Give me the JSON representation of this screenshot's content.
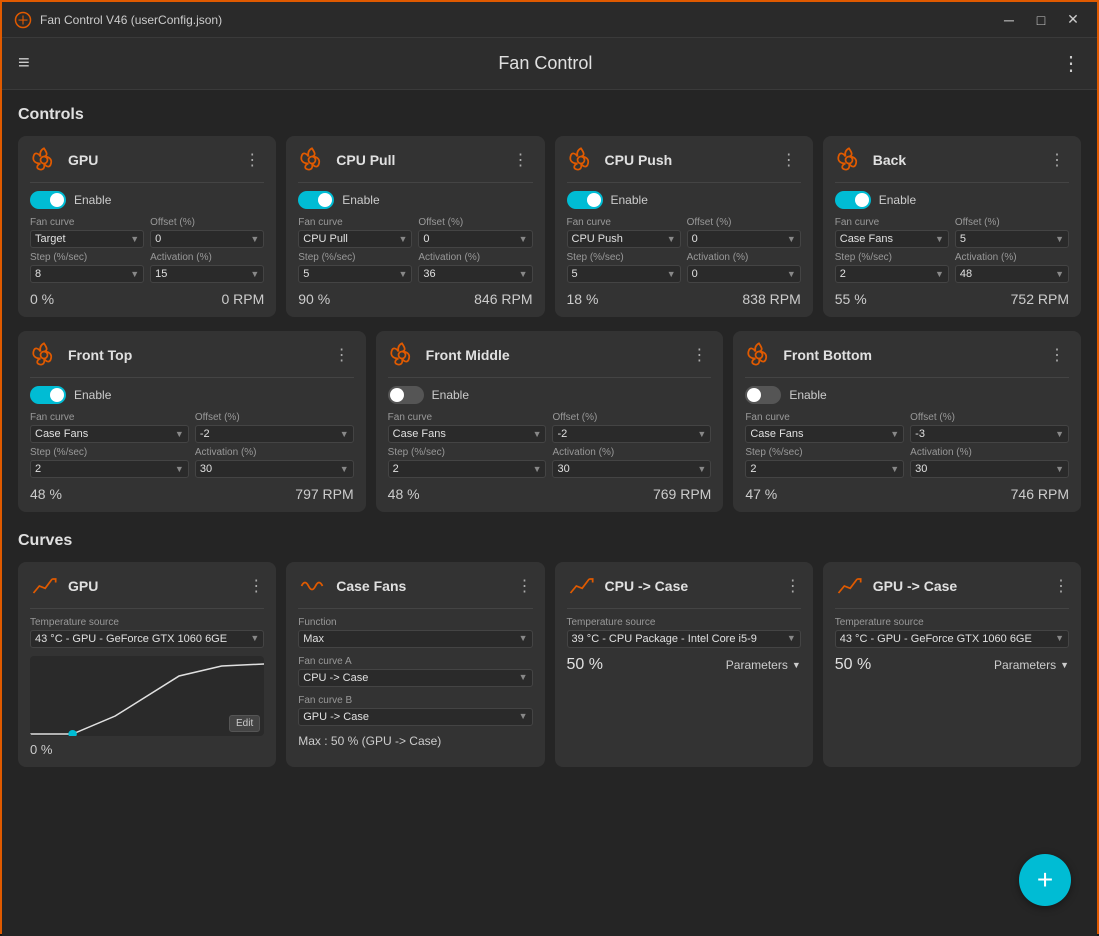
{
  "window": {
    "title": "Fan Control V46 (userConfig.json)",
    "min_btn": "─",
    "max_btn": "□",
    "close_btn": "✕"
  },
  "topbar": {
    "menu_icon": "≡",
    "title": "Fan Control",
    "more_icon": "⋮"
  },
  "controls_section": {
    "title": "Controls"
  },
  "curves_section": {
    "title": "Curves"
  },
  "control_cards": [
    {
      "id": "gpu",
      "title": "GPU",
      "enabled": true,
      "fan_curve_label": "Fan curve",
      "fan_curve_value": "Target",
      "offset_label": "Offset (%)",
      "offset_value": "0",
      "step_label": "Step (%/sec)",
      "step_value": "8",
      "activation_label": "Activation (%)",
      "activation_value": "15",
      "percent": "0 %",
      "rpm": "0 RPM"
    },
    {
      "id": "cpu-pull",
      "title": "CPU Pull",
      "enabled": true,
      "fan_curve_label": "Fan curve",
      "fan_curve_value": "CPU Pull",
      "offset_label": "Offset (%)",
      "offset_value": "0",
      "step_label": "Step (%/sec)",
      "step_value": "5",
      "activation_label": "Activation (%)",
      "activation_value": "36",
      "percent": "90 %",
      "rpm": "846 RPM"
    },
    {
      "id": "cpu-push",
      "title": "CPU Push",
      "enabled": true,
      "fan_curve_label": "Fan curve",
      "fan_curve_value": "CPU Push",
      "offset_label": "Offset (%)",
      "offset_value": "0",
      "step_label": "Step (%/sec)",
      "step_value": "5",
      "activation_label": "Activation (%)",
      "activation_value": "0",
      "percent": "18 %",
      "rpm": "838 RPM"
    },
    {
      "id": "back",
      "title": "Back",
      "enabled": true,
      "fan_curve_label": "Fan curve",
      "fan_curve_value": "Case Fans",
      "offset_label": "Offset (%)",
      "offset_value": "5",
      "step_label": "Step (%/sec)",
      "step_value": "2",
      "activation_label": "Activation (%)",
      "activation_value": "48",
      "percent": "55 %",
      "rpm": "752 RPM"
    },
    {
      "id": "front-top",
      "title": "Front Top",
      "enabled": true,
      "fan_curve_label": "Fan curve",
      "fan_curve_value": "Case Fans",
      "offset_label": "Offset (%)",
      "offset_value": "-2",
      "step_label": "Step (%/sec)",
      "step_value": "2",
      "activation_label": "Activation (%)",
      "activation_value": "30",
      "percent": "48 %",
      "rpm": "797 RPM"
    },
    {
      "id": "front-middle",
      "title": "Front Middle",
      "enabled": false,
      "fan_curve_label": "Fan curve",
      "fan_curve_value": "Case Fans",
      "offset_label": "Offset (%)",
      "offset_value": "-2",
      "step_label": "Step (%/sec)",
      "step_value": "2",
      "activation_label": "Activation (%)",
      "activation_value": "30",
      "percent": "48 %",
      "rpm": "769 RPM"
    },
    {
      "id": "front-bottom",
      "title": "Front Bottom",
      "enabled": false,
      "fan_curve_label": "Fan curve",
      "fan_curve_value": "Case Fans",
      "offset_label": "Offset (%)",
      "offset_value": "-3",
      "step_label": "Step (%/sec)",
      "step_value": "2",
      "activation_label": "Activation (%)",
      "activation_value": "30",
      "percent": "47 %",
      "rpm": "746 RPM"
    }
  ],
  "curve_cards": [
    {
      "id": "gpu-curve",
      "title": "GPU",
      "icon": "linear",
      "temp_source_label": "Temperature source",
      "temp_source_value": "43 °C - GPU - GeForce GTX 1060 6GE",
      "show_chart": true,
      "chart_percent": "0 %",
      "edit_label": "Edit"
    },
    {
      "id": "case-fans-curve",
      "title": "Case Fans",
      "icon": "max",
      "function_label": "Function",
      "function_value": "Max",
      "fan_curve_a_label": "Fan curve A",
      "fan_curve_a_value": "CPU -> Case",
      "fan_curve_b_label": "Fan curve B",
      "fan_curve_b_value": "GPU -> Case",
      "max_info": "Max : 50 % (GPU -> Case)"
    },
    {
      "id": "cpu-case-curve",
      "title": "CPU -> Case",
      "icon": "linear",
      "temp_source_label": "Temperature source",
      "temp_source_value": "39 °C - CPU Package - Intel Core i5-9",
      "percent": "50 %",
      "params_label": "Parameters"
    },
    {
      "id": "gpu-case-curve",
      "title": "GPU -> Case",
      "icon": "linear",
      "temp_source_label": "Temperature source",
      "temp_source_value": "43 °C - GPU - GeForce GTX 1060 6GE",
      "percent": "50 %",
      "params_label": "Parameters"
    }
  ],
  "fab": {
    "label": "+"
  }
}
